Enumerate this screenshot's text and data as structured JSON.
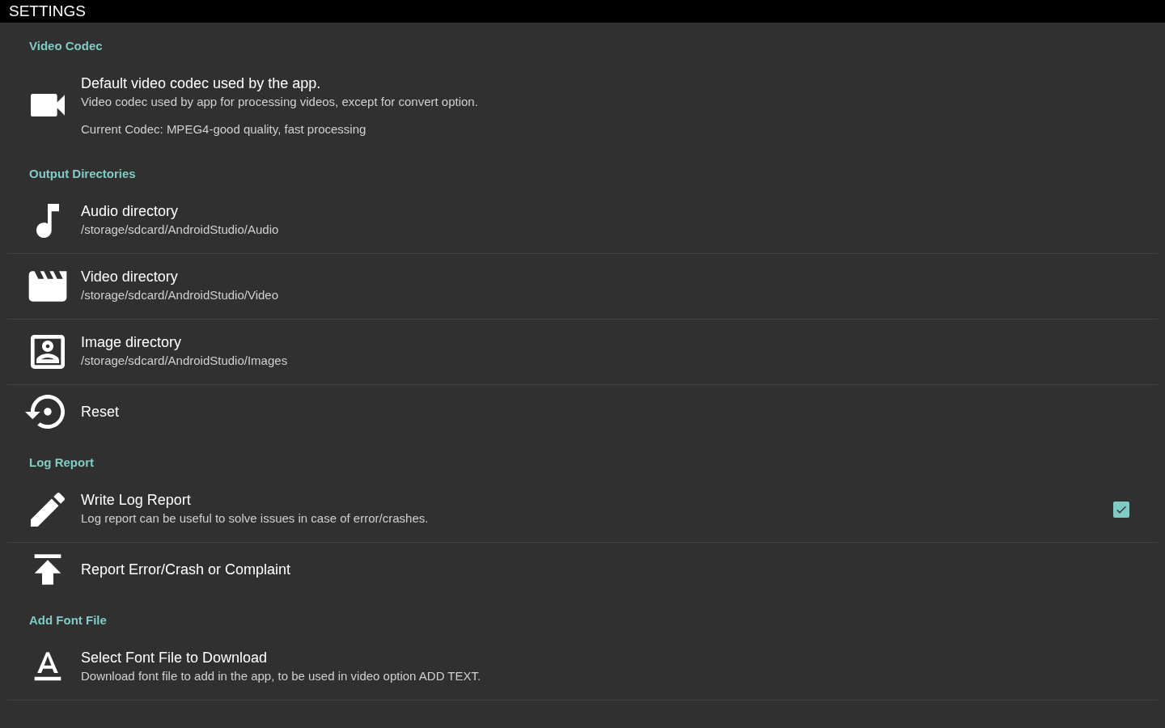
{
  "app_bar": {
    "title": "SETTINGS"
  },
  "sections": [
    {
      "header": "Video Codec",
      "items": [
        {
          "title": "Default video codec used by the app.",
          "summary": "Video codec used by app for processing videos, except for convert option.",
          "detail": "Current Codec: MPEG4-good quality, fast processing"
        }
      ]
    },
    {
      "header": "Output Directories",
      "items": [
        {
          "title": "Audio directory",
          "summary": "/storage/sdcard/AndroidStudio/Audio"
        },
        {
          "title": "Video directory",
          "summary": "/storage/sdcard/AndroidStudio/Video"
        },
        {
          "title": "Image directory",
          "summary": "/storage/sdcard/AndroidStudio/Images"
        },
        {
          "title": "Reset"
        }
      ]
    },
    {
      "header": "Log Report",
      "items": [
        {
          "title": "Write Log Report",
          "summary": "Log report can be useful to solve issues in case of error/crashes.",
          "checked": true
        },
        {
          "title": "Report Error/Crash or Complaint"
        }
      ]
    },
    {
      "header": "Add Font File",
      "items": [
        {
          "title": "Select Font File to Download",
          "summary": "Download font file to add in the app, to be used in video option ADD TEXT."
        }
      ]
    }
  ]
}
